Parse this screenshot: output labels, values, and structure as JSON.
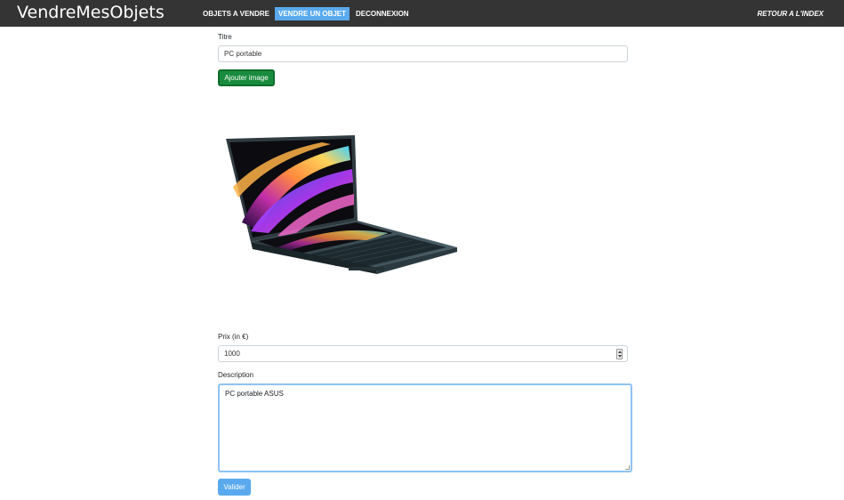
{
  "nav": {
    "brand": "VendreMesObjets",
    "objects_link": "OBJETS A VENDRE",
    "sell_link": "VENDRE UN OBJET",
    "logout_link": "DECONNEXION",
    "index_link": "RETOUR A L'INDEX"
  },
  "form": {
    "title_label": "Titre",
    "title_value": "PC portable",
    "add_image_label": "Ajouter image",
    "price_label": "Prix (in €)",
    "price_value": "1000",
    "description_label": "Description",
    "description_value": "PC portable ASUS",
    "submit_label": "Valider"
  },
  "colors": {
    "navbar": "#343434",
    "active_nav": "#5aa9ee",
    "add_button": "#198b3e",
    "submit_button": "#5aa9ee"
  }
}
